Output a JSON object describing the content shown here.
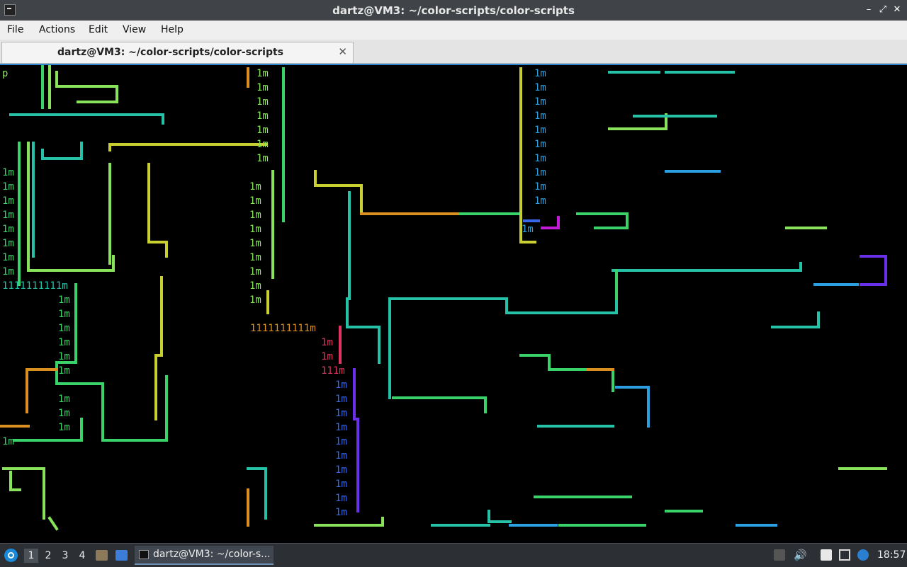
{
  "window": {
    "title": "dartz@VM3: ~/color-scripts/color-scripts",
    "controls": {
      "minimize": "–",
      "restore": "⤢",
      "close": "✕"
    }
  },
  "menubar": {
    "items": [
      "File",
      "Actions",
      "Edit",
      "View",
      "Help"
    ]
  },
  "tabs": [
    {
      "label": "dartz@VM3: ~/color-scripts/color-scripts",
      "close": "✕"
    }
  ],
  "terminal": {
    "description_icon": "terminal-output",
    "palette": [
      "#88e35a",
      "#3ad36a",
      "#26c2a8",
      "#2b9fe0",
      "#3567e8",
      "#6a2fe8",
      "#c21ad6",
      "#e03560",
      "#d99020",
      "#c8cf30"
    ],
    "text_fragments": [
      "p",
      "m",
      "1m",
      "1111111111m",
      "111m"
    ]
  },
  "taskbar": {
    "desktops": [
      "1",
      "2",
      "3",
      "4"
    ],
    "active_desktop": "1",
    "task_label": "dartz@VM3: ~/color-s...",
    "clock": "18:57"
  }
}
